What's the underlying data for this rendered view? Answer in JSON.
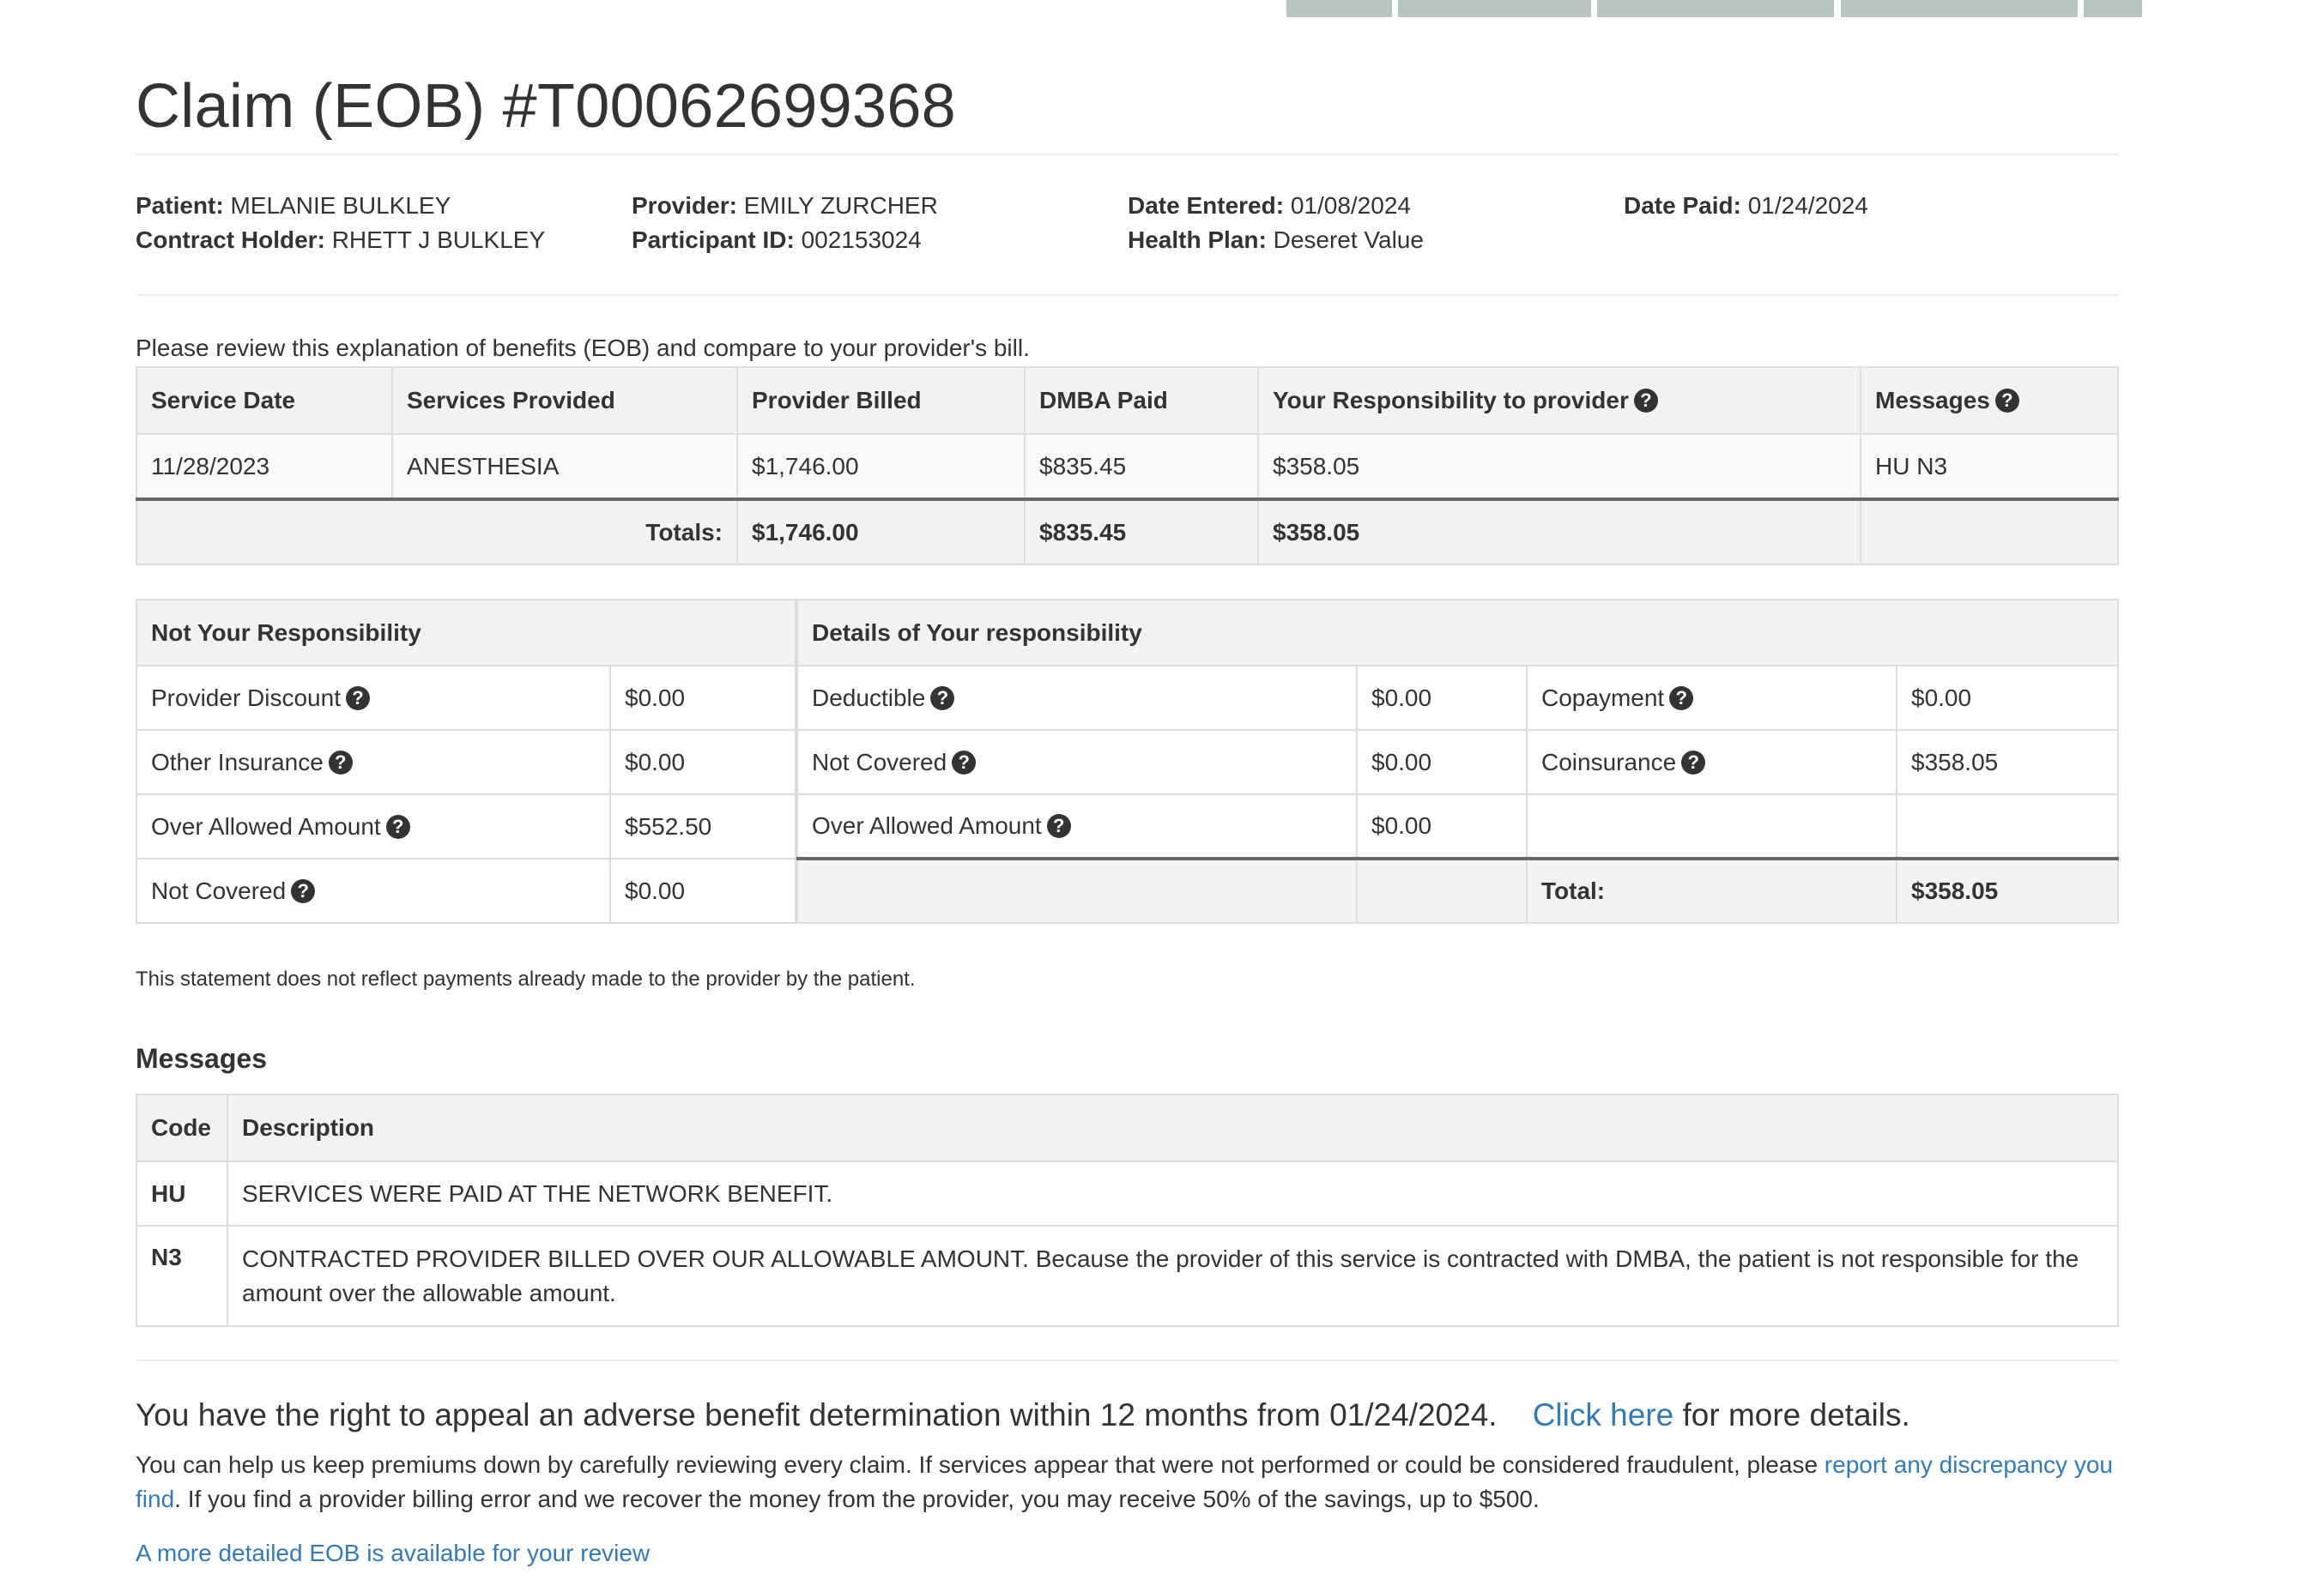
{
  "title": "Claim (EOB) #T00062699368",
  "claim_info": {
    "patient_label": "Patient:",
    "patient": "MELANIE BULKLEY",
    "contract_holder_label": "Contract Holder:",
    "contract_holder": "RHETT J BULKLEY",
    "provider_label": "Provider:",
    "provider": "EMILY ZURCHER",
    "participant_id_label": "Participant ID:",
    "participant_id": "002153024",
    "date_entered_label": "Date Entered:",
    "date_entered": "01/08/2024",
    "health_plan_label": "Health Plan:",
    "health_plan": "Deseret Value",
    "date_paid_label": "Date Paid:",
    "date_paid": "01/24/2024"
  },
  "intro_text": "Please review this explanation of benefits (EOB) and compare to your provider's bill.",
  "service_table": {
    "headers": [
      "Service Date",
      "Services Provided",
      "Provider Billed",
      "DMBA Paid",
      "Your Responsibility to provider",
      "Messages"
    ],
    "rows": [
      [
        "11/28/2023",
        "ANESTHESIA",
        "$1,746.00",
        "$835.45",
        "$358.05",
        "HU N3"
      ]
    ],
    "totals_label": "Totals:",
    "totals": [
      "$1,746.00",
      "$835.45",
      "$358.05"
    ]
  },
  "not_your_responsibility": {
    "header": "Not Your Responsibility",
    "rows": [
      {
        "label": "Provider Discount",
        "value": "$0.00"
      },
      {
        "label": "Other Insurance",
        "value": "$0.00"
      },
      {
        "label": "Over Allowed Amount",
        "value": "$552.50"
      },
      {
        "label": "Not Covered",
        "value": "$0.00"
      }
    ]
  },
  "details_responsibility": {
    "header": "Details of Your responsibility",
    "rows": [
      {
        "label": "Deductible",
        "value": "$0.00",
        "label2": "Copayment",
        "value2": "$0.00"
      },
      {
        "label": "Not Covered",
        "value": "$0.00",
        "label2": "Coinsurance",
        "value2": "$358.05"
      },
      {
        "label": "Over Allowed Amount",
        "value": "$0.00"
      }
    ],
    "total_label": "Total:",
    "total": "$358.05"
  },
  "statement_note": "This statement does not reflect payments already made to the provider by the patient.",
  "messages": {
    "heading": "Messages",
    "headers": [
      "Code",
      "Description"
    ],
    "rows": [
      {
        "code": "HU",
        "description": "SERVICES WERE PAID AT THE NETWORK BENEFIT."
      },
      {
        "code": "N3",
        "description": "CONTRACTED PROVIDER BILLED OVER OUR ALLOWABLE AMOUNT. Because the provider of this service is contracted with DMBA, the patient is not responsible for the amount over the allowable amount."
      }
    ]
  },
  "appeal": {
    "text": "You have the right to appeal an adverse benefit determination within 12 months from 01/24/2024.",
    "link": "Click here",
    "suffix": "for more details."
  },
  "help": {
    "text1": "You can help us keep premiums down by carefully reviewing every claim. If services appear that were not performed or could be considered fraudulent, please",
    "link": "report any discrepancy you find",
    "text2": ". If you find a provider billing error and we recover the money from the provider, you may receive 50% of the savings, up to $500."
  },
  "detailed_eob_link": "A more detailed EOB is available for your review",
  "colors": {
    "link": "#337ab7",
    "header_bg": "#f2f2f2",
    "tab_gray": "#b6c4c2"
  }
}
